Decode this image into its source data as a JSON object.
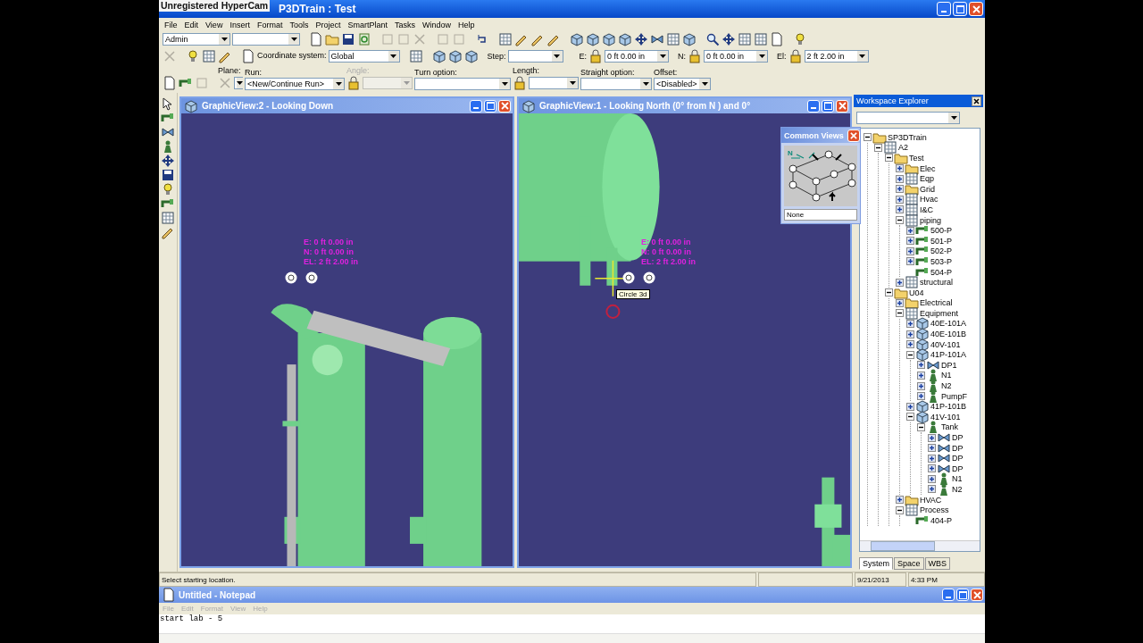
{
  "recorder_overlay": "Unregistered HyperCam",
  "window": {
    "title": "P3DTrain : Test"
  },
  "menu": [
    "File",
    "Edit",
    "View",
    "Insert",
    "Format",
    "Tools",
    "Project",
    "SmartPlant",
    "Tasks",
    "Window",
    "Help"
  ],
  "toolbar": {
    "user": "Admin"
  },
  "position_bar": {
    "coordinate_label": "Coordinate system:",
    "coordinate_value": "Global",
    "step_label": "Step:",
    "positions": [
      {
        "label": "E:",
        "value": "0 ft 0.00 in"
      },
      {
        "label": "N:",
        "value": "0 ft 0.00 in"
      },
      {
        "label": "El:",
        "value": "2 ft 2.00 in"
      }
    ]
  },
  "route_bar": {
    "fields": [
      {
        "label": "Plane:",
        "kind": "plane",
        "disabled": false
      },
      {
        "label": "Run:",
        "kind": "combo",
        "value": "<New/Continue Run>",
        "disabled": false
      },
      {
        "label": "Angle:",
        "kind": "locked",
        "disabled": true
      },
      {
        "label": "Turn option:",
        "kind": "combo",
        "disabled": false
      },
      {
        "label": "Length:",
        "kind": "locked",
        "disabled": false
      },
      {
        "label": "Straight option:",
        "kind": "combo",
        "disabled": false
      },
      {
        "label": "Offset:",
        "kind": "small",
        "value": "<Disabled>",
        "disabled": false
      }
    ]
  },
  "views": [
    {
      "title": "GraphicView:2 - Looking Down",
      "kind": "plan",
      "coords": [
        "E: 0 ft 0.00 in",
        "N: 0 ft 0.00 in",
        "EL: 2 ft 2.00 in"
      ]
    },
    {
      "title": "GraphicView:1 - Looking North (0° from N ) and 0°",
      "kind": "elevation",
      "coords": [
        "E: 0 ft 0.00 in",
        "N: 0 ft 0.00 in",
        "EL: 2 ft 2.00 in"
      ],
      "tooltip": "Circle 3d"
    }
  ],
  "common_views": {
    "title": "Common Views",
    "compass": "N",
    "value": "None"
  },
  "explorer": {
    "title": "Workspace Explorer",
    "tree": [
      {
        "label": "SP3DTrain",
        "kind": "folder",
        "expanded": true,
        "children": [
          {
            "label": "A2",
            "kind": "system",
            "expanded": true,
            "children": [
              {
                "label": "Test",
                "kind": "folder",
                "expanded": true,
                "children": [
                  {
                    "label": "Elec",
                    "kind": "folder",
                    "expanded": false
                  },
                  {
                    "label": "Eqp",
                    "kind": "system",
                    "expanded": false
                  },
                  {
                    "label": "Grid",
                    "kind": "folder",
                    "expanded": false
                  },
                  {
                    "label": "Hvac",
                    "kind": "system",
                    "expanded": false
                  },
                  {
                    "label": "I&C",
                    "kind": "system",
                    "expanded": false
                  },
                  {
                    "label": "piping",
                    "kind": "system",
                    "expanded": true,
                    "children": [
                      {
                        "label": "500-P",
                        "kind": "run",
                        "expanded": false
                      },
                      {
                        "label": "501-P",
                        "kind": "run",
                        "expanded": false
                      },
                      {
                        "label": "502-P",
                        "kind": "run",
                        "expanded": false
                      },
                      {
                        "label": "503-P",
                        "kind": "run",
                        "expanded": false
                      },
                      {
                        "label": "504-P",
                        "kind": "run"
                      }
                    ]
                  },
                  {
                    "label": "structural",
                    "kind": "system",
                    "expanded": false
                  }
                ]
              },
              {
                "label": "U04",
                "kind": "folder",
                "expanded": true,
                "children": [
                  {
                    "label": "Electrical",
                    "kind": "folder",
                    "expanded": false
                  },
                  {
                    "label": "Equipment",
                    "kind": "system",
                    "expanded": true,
                    "children": [
                      {
                        "label": "40E-101A",
                        "kind": "equipment",
                        "expanded": false
                      },
                      {
                        "label": "40E-101B",
                        "kind": "equipment",
                        "expanded": false
                      },
                      {
                        "label": "40V-101",
                        "kind": "equipment",
                        "expanded": false
                      },
                      {
                        "label": "41P-101A",
                        "kind": "equipment",
                        "expanded": true,
                        "children": [
                          {
                            "label": "DP1",
                            "kind": "port",
                            "expanded": false
                          },
                          {
                            "label": "N1",
                            "kind": "nozzle",
                            "expanded": false
                          },
                          {
                            "label": "N2",
                            "kind": "nozzle",
                            "expanded": false
                          },
                          {
                            "label": "PumpF",
                            "kind": "nozzle",
                            "expanded": false
                          }
                        ]
                      },
                      {
                        "label": "41P-101B",
                        "kind": "equipment",
                        "expanded": false
                      },
                      {
                        "label": "41V-101",
                        "kind": "equipment",
                        "expanded": true,
                        "children": [
                          {
                            "label": "Tank",
                            "kind": "nozzle",
                            "expanded": true,
                            "children": [
                              {
                                "label": "DP",
                                "kind": "port",
                                "expanded": false
                              },
                              {
                                "label": "DP",
                                "kind": "port",
                                "expanded": false
                              },
                              {
                                "label": "DP",
                                "kind": "port",
                                "expanded": false
                              },
                              {
                                "label": "DP",
                                "kind": "port",
                                "expanded": false
                              },
                              {
                                "label": "N1",
                                "kind": "nozzle",
                                "expanded": false
                              },
                              {
                                "label": "N2",
                                "kind": "nozzle",
                                "expanded": false
                              }
                            ]
                          }
                        ]
                      }
                    ]
                  },
                  {
                    "label": "HVAC",
                    "kind": "folder",
                    "expanded": false
                  },
                  {
                    "label": "Process",
                    "kind": "system",
                    "expanded": true,
                    "children": [
                      {
                        "label": "404-P",
                        "kind": "run"
                      }
                    ]
                  }
                ]
              }
            ]
          }
        ]
      }
    ],
    "tabs": [
      {
        "label": "System",
        "selected": true
      },
      {
        "label": "Space",
        "selected": false
      },
      {
        "label": "WBS",
        "selected": false
      }
    ]
  },
  "status_bar": {
    "message": "Select starting location.",
    "date": "9/21/2013",
    "time": "4:33 PM"
  },
  "notepad": {
    "title": "Untitled - Notepad",
    "menu": [
      "File",
      "Edit",
      "Format",
      "View",
      "Help"
    ],
    "text": "start lab - 5"
  }
}
